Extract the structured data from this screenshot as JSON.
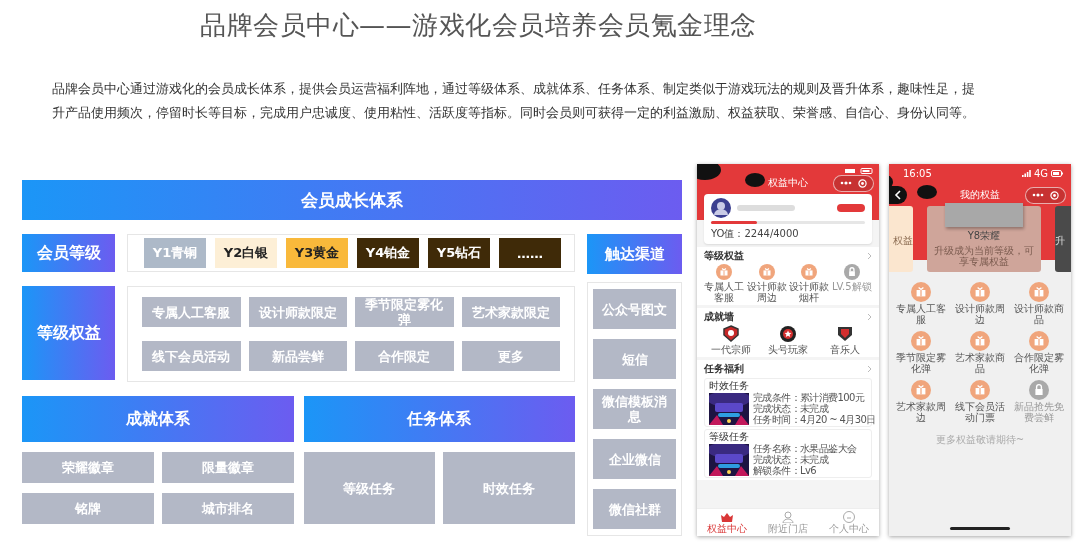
{
  "title": "品牌会员中心——游戏化会员培养会员氪金理念",
  "intro": "品牌会员中心通过游戏化的会员成长体系，提供会员运营福利阵地，通过等级体系、成就体系、任务体系、制定类似于游戏玩法的规则及晋升体系，趣味性足，提升产品使用频次，停留时长等目标，完成用户忠诚度、使用粘性、活跃度等指标。同时会员则可获得一定的利益激励、权益获取、荣誉感、自信心、身份认同等。",
  "diagram": {
    "header": "会员成长体系",
    "levels": {
      "label": "会员等级",
      "items": [
        {
          "text": "Y1青铜",
          "color": "#adb9c8"
        },
        {
          "text": "Y2白银",
          "color": "#fdefd6"
        },
        {
          "text": "Y3黄金",
          "color": "#f9b93b"
        },
        {
          "text": "Y4铂金",
          "color": "#3f2a08"
        },
        {
          "text": "Y5钻石",
          "color": "#3f2a08"
        },
        {
          "text": "……",
          "color": "#3f2a08"
        }
      ]
    },
    "rights": {
      "label": "等级权益",
      "items": [
        "专属人工客服",
        "设计师款限定",
        "季节限定雾化弹",
        "艺术家款限定",
        "线下会员活动",
        "新品尝鲜",
        "合作限定",
        "更多"
      ]
    },
    "achievements": {
      "label": "成就体系",
      "items": [
        "荣耀徽章",
        "限量徽章",
        "铭牌",
        "城市排名"
      ]
    },
    "tasks": {
      "label": "任务体系",
      "items": [
        "等级任务",
        "时效任务"
      ]
    },
    "channels": {
      "label": "触达渠道",
      "items": [
        "公众号图文",
        "短信",
        "微信模板消息",
        "企业微信",
        "微信社群"
      ]
    }
  },
  "phone_1": {
    "title": "权益中心",
    "progress": {
      "level": 0.3,
      "reading": "YO值：2244/4000"
    },
    "benefits": {
      "title": "等级权益",
      "items": [
        {
          "label": "专属人工客服",
          "locked": false
        },
        {
          "label": "设计师款周边",
          "locked": false
        },
        {
          "label": "设计师款烟杆",
          "locked": false
        },
        {
          "label": "LV.5解锁",
          "locked": true
        }
      ]
    },
    "badges": {
      "title": "成就墙",
      "items": [
        "一代宗师",
        "头号玩家",
        "音乐人"
      ]
    },
    "tasks": {
      "title": "任务福利",
      "items": [
        {
          "title": "时效任务",
          "lines": [
            "完成条件：累计消费100元",
            "完成状态：未完成",
            "任务时间：4月20 ~ 4月30日"
          ]
        },
        {
          "title": "等级任务",
          "lines": [
            "任务名称：水果品鉴大会",
            "完成状态：未完成",
            "解锁条件：Lv6"
          ]
        }
      ]
    },
    "tabs": [
      {
        "label": "权益中心",
        "selected": true
      },
      {
        "label": "附近门店",
        "selected": false
      },
      {
        "label": "个人中心",
        "selected": false
      }
    ]
  },
  "phone_2": {
    "time": "16:05",
    "network": "4G",
    "title": "我的权益",
    "carousel": {
      "previous": "权益",
      "next": "升",
      "current": {
        "name": "Y8荣耀",
        "note": "升级成为当前等级，可享专属权益"
      }
    },
    "benefits": [
      {
        "label": "专属人工客服",
        "locked": false
      },
      {
        "label": "设计师款周边",
        "locked": false
      },
      {
        "label": "设计师款商品",
        "locked": false
      },
      {
        "label": "季节限定雾化弹",
        "locked": false
      },
      {
        "label": "艺术家款商品",
        "locked": false
      },
      {
        "label": "合作限定雾化弹",
        "locked": false
      },
      {
        "label": "艺术家款周边",
        "locked": false
      },
      {
        "label": "线下会员活动门票",
        "locked": false
      },
      {
        "label": "新品抢先免费尝鲜",
        "locked": true
      }
    ],
    "footer": "更多权益敬请期待~"
  }
}
